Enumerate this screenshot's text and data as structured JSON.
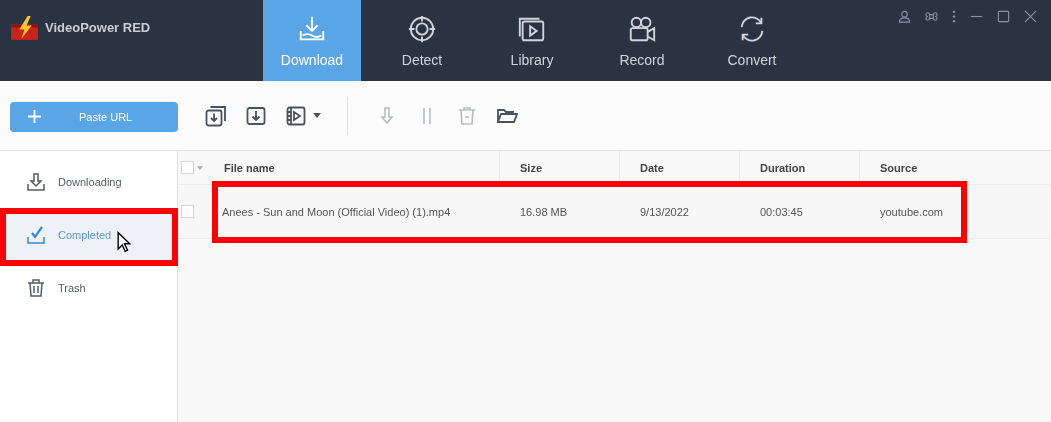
{
  "app": {
    "title": "VideoPower RED"
  },
  "tabs": [
    {
      "label": "Download",
      "selected": true
    },
    {
      "label": "Detect",
      "selected": false
    },
    {
      "label": "Library",
      "selected": false
    },
    {
      "label": "Record",
      "selected": false
    },
    {
      "label": "Convert",
      "selected": false
    }
  ],
  "toolbar": {
    "paste_button": "Paste URL"
  },
  "sidebar": {
    "items": [
      {
        "label": "Downloading",
        "selected": false,
        "highlighted": false
      },
      {
        "label": "Completed",
        "selected": true,
        "highlighted": true
      },
      {
        "label": "Trash",
        "selected": false,
        "highlighted": false
      }
    ]
  },
  "table": {
    "select_all_checked": false,
    "columns": [
      "File name",
      "Size",
      "Date",
      "Duration",
      "Source"
    ],
    "rows": [
      {
        "checked": false,
        "highlighted": true,
        "cells": [
          "Anees - Sun and Moon (Official Video) (1).mp4",
          "16.98 MB",
          "9/13/2022",
          "00:03:45",
          "youtube.com"
        ]
      }
    ]
  }
}
